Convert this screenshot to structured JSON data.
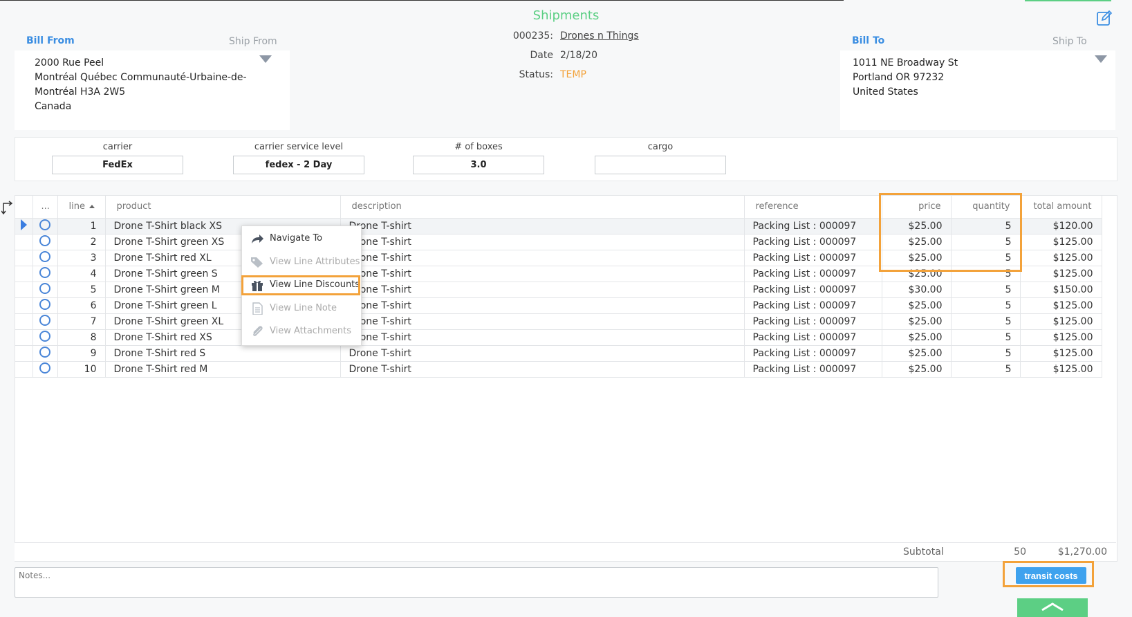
{
  "title": "Shipments",
  "header": {
    "bill_from_label": "Bill From",
    "ship_from_label": "Ship From",
    "bill_to_label": "Bill To",
    "ship_to_label": "Ship To",
    "bill_from_lines": [
      "2000 Rue Peel",
      "Montréal Québec Communauté-Urbaine-de-",
      "Montréal H3A 2W5",
      "Canada"
    ],
    "bill_to_lines": [
      "1011 NE Broadway St",
      "Portland OR 97232",
      "United States"
    ],
    "doc_number": "000235:",
    "customer": "Drones n Things",
    "date_label": "Date",
    "date_value": "2/18/20",
    "status_label": "Status:",
    "status_value": "TEMP"
  },
  "shipping": {
    "carrier_label": "carrier",
    "carrier_value": "FedEx",
    "service_label": "carrier service level",
    "service_value": "fedex - 2 Day",
    "boxes_label": "# of boxes",
    "boxes_value": "3.0",
    "cargo_label": "cargo",
    "cargo_value": ""
  },
  "grid": {
    "columns": {
      "dots": "...",
      "line": "line",
      "product": "product",
      "description": "description",
      "reference": "reference",
      "price": "price",
      "quantity": "quantity",
      "total": "total amount"
    },
    "rows": [
      {
        "line": "1",
        "product": "Drone T-Shirt black XS",
        "description": "Drone T-shirt",
        "reference": "Packing List : 000097",
        "price": "$25.00",
        "quantity": "5",
        "total": "$120.00"
      },
      {
        "line": "2",
        "product": "Drone T-Shirt green XS",
        "description": "Drone T-shirt",
        "reference": "Packing List : 000097",
        "price": "$25.00",
        "quantity": "5",
        "total": "$125.00"
      },
      {
        "line": "3",
        "product": "Drone T-Shirt red XL",
        "description": "Drone T-shirt",
        "reference": "Packing List : 000097",
        "price": "$25.00",
        "quantity": "5",
        "total": "$125.00"
      },
      {
        "line": "4",
        "product": "Drone T-Shirt green S",
        "description": "Drone T-shirt",
        "reference": "Packing List : 000097",
        "price": "$25.00",
        "quantity": "5",
        "total": "$125.00"
      },
      {
        "line": "5",
        "product": "Drone T-Shirt green M",
        "description": "Drone T-shirt",
        "reference": "Packing List : 000097",
        "price": "$30.00",
        "quantity": "5",
        "total": "$150.00"
      },
      {
        "line": "6",
        "product": "Drone T-Shirt green L",
        "description": "Drone T-shirt",
        "reference": "Packing List : 000097",
        "price": "$25.00",
        "quantity": "5",
        "total": "$125.00"
      },
      {
        "line": "7",
        "product": "Drone T-Shirt green XL",
        "description": "Drone T-shirt",
        "reference": "Packing List : 000097",
        "price": "$25.00",
        "quantity": "5",
        "total": "$125.00"
      },
      {
        "line": "8",
        "product": "Drone T-Shirt red XS",
        "description": "Drone T-shirt",
        "reference": "Packing List : 000097",
        "price": "$25.00",
        "quantity": "5",
        "total": "$125.00"
      },
      {
        "line": "9",
        "product": "Drone T-Shirt red S",
        "description": "Drone T-shirt",
        "reference": "Packing List : 000097",
        "price": "$25.00",
        "quantity": "5",
        "total": "$125.00"
      },
      {
        "line": "10",
        "product": "Drone T-Shirt red M",
        "description": "Drone T-shirt",
        "reference": "Packing List : 000097",
        "price": "$25.00",
        "quantity": "5",
        "total": "$125.00"
      }
    ],
    "subtotal_label": "Subtotal",
    "subtotal_quantity": "50",
    "subtotal_amount": "$1,270.00"
  },
  "context_menu": {
    "items": [
      {
        "label": "Navigate To",
        "enabled": true,
        "icon": "share-arrow-icon"
      },
      {
        "label": "View Line Attributes",
        "enabled": false,
        "icon": "tag-icon"
      },
      {
        "label": "View Line Discounts",
        "enabled": true,
        "icon": "gift-icon"
      },
      {
        "label": "View Line Note",
        "enabled": false,
        "icon": "note-icon"
      },
      {
        "label": "View Attachments",
        "enabled": false,
        "icon": "paperclip-icon"
      }
    ]
  },
  "notes": {
    "placeholder": "Notes..."
  },
  "footer": {
    "transit_costs_label": "transit costs"
  },
  "colors": {
    "accent_green": "#5ccf84",
    "link_blue": "#3b8ee2",
    "status_orange": "#f3a23a",
    "button_blue": "#3ea2ee",
    "highlight_orange": "#f3a23a"
  }
}
